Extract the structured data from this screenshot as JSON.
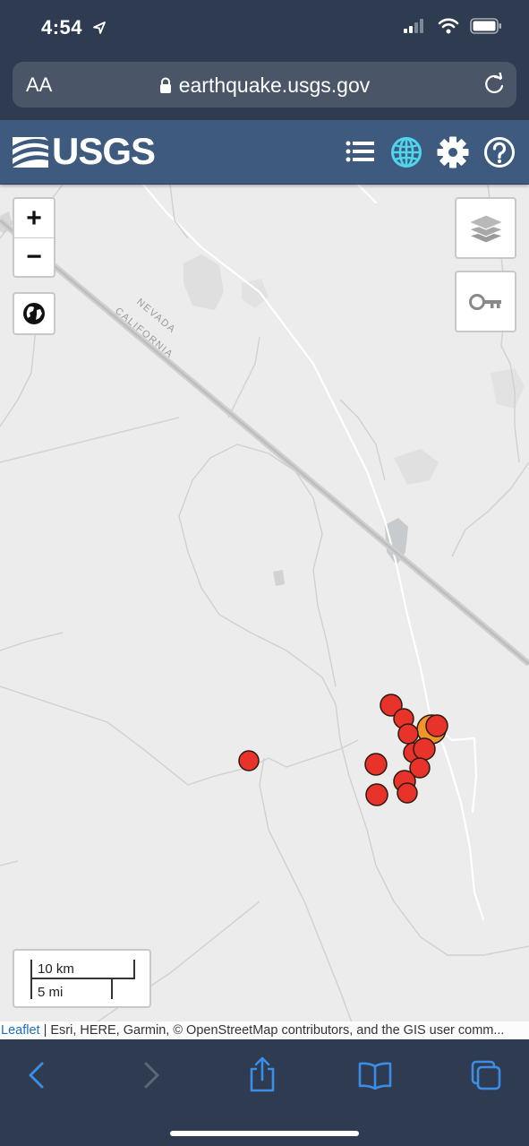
{
  "status": {
    "time": "4:54"
  },
  "browser": {
    "text_size_label": "AA",
    "url": "earthquake.usgs.gov"
  },
  "header": {
    "logo_text": "USGS"
  },
  "map": {
    "zoom_in_label": "+",
    "zoom_out_label": "−",
    "state_labels": [
      "NEVADA",
      "CALIFORNIA"
    ],
    "scale": {
      "km_label": "10 km",
      "mi_label": "5 mi"
    },
    "attribution_link": "Leaflet",
    "attribution_text": " | Esri, HERE, Garmin, © OpenStreetMap contributors, and the GIS user comm..."
  },
  "colors": {
    "chrome": "#2e3b50",
    "usgs_blue": "#3f5a7f",
    "quake_red": "#e8332a",
    "quake_orange": "#f0952b",
    "link_blue": "#1f6fb5",
    "icon_blue": "#3b8ee8"
  }
}
